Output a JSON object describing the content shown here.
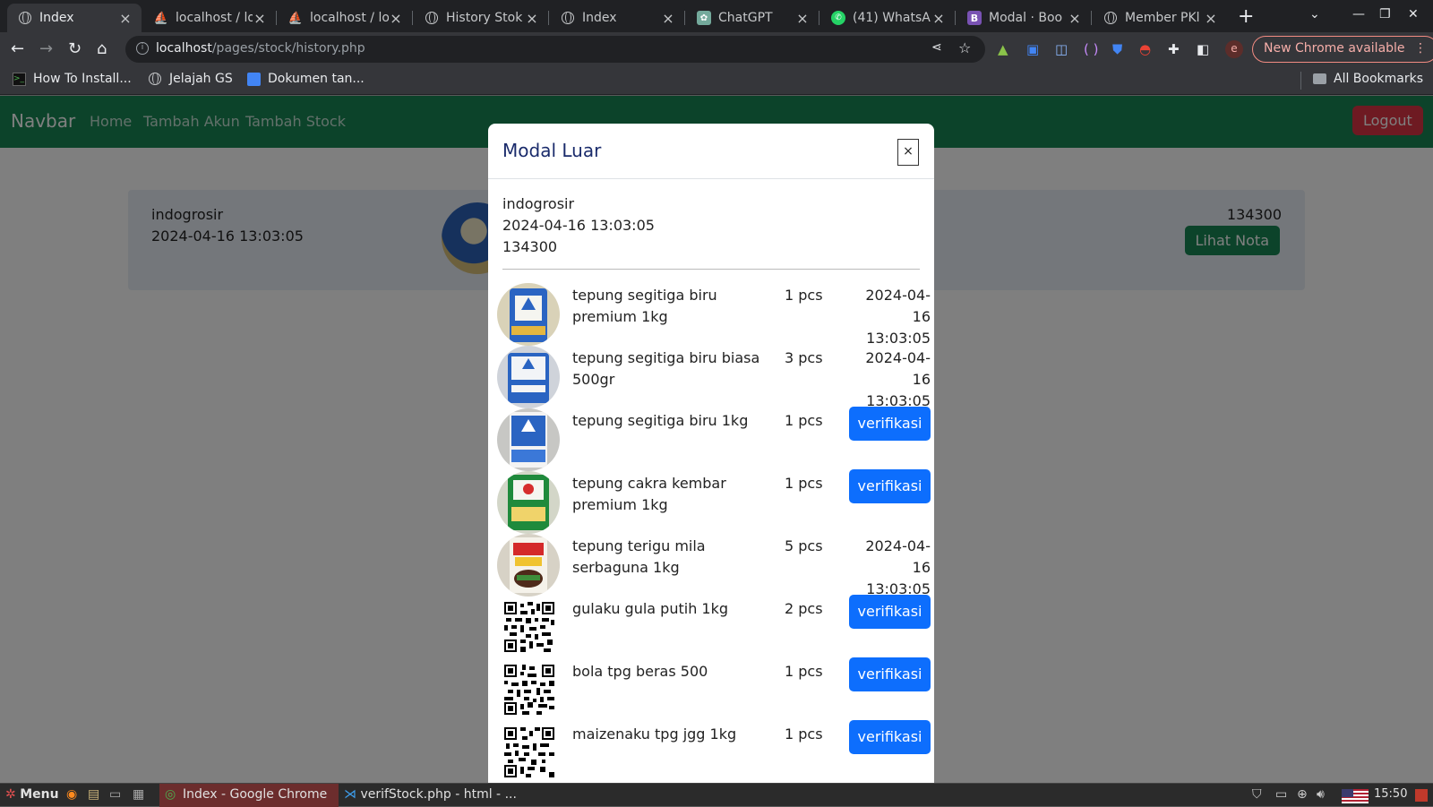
{
  "browser": {
    "tabs": [
      {
        "title": "Index",
        "icon": "globe-icon",
        "active": true
      },
      {
        "title": "localhost / lo",
        "icon": "phpmyadmin-icon"
      },
      {
        "title": "localhost / lo",
        "icon": "phpmyadmin-icon"
      },
      {
        "title": "History Stok",
        "icon": "globe-icon"
      },
      {
        "title": "Index",
        "icon": "globe-icon"
      },
      {
        "title": "ChatGPT",
        "icon": "chatgpt-icon"
      },
      {
        "title": "(41) WhatsA",
        "icon": "whatsapp-icon"
      },
      {
        "title": "Modal · Boo",
        "icon": "bootstrap-icon"
      },
      {
        "title": "Member PKl",
        "icon": "globe-icon"
      }
    ],
    "url_host": "localhost",
    "url_path": "/pages/stock/history.php",
    "update_button": "New Chrome available",
    "profile_initial": "e",
    "bookmarks": [
      "How To Install...",
      "Jelajah GS",
      "Dokumen tan..."
    ],
    "all_bookmarks": "All Bookmarks"
  },
  "navbar": {
    "brand": "Navbar",
    "links": [
      "Home",
      "Tambah Akun",
      "Tambah Stock"
    ],
    "logout": "Logout"
  },
  "card": {
    "store": "indogrosir",
    "date": "2024-04-16 13:03:05",
    "total": "134300",
    "button": "Lihat Nota"
  },
  "modal": {
    "title": "Modal Luar",
    "close": "×",
    "store": "indogrosir",
    "date": "2024-04-16 13:03:05",
    "total": "134300",
    "items": [
      {
        "name": "tepung segitiga biru premium 1kg",
        "qty": "1 pcs",
        "status_date": "2024-04-16 13:03:05",
        "verified": true
      },
      {
        "name": "tepung segitiga biru biasa 500gr",
        "qty": "3 pcs",
        "status_date": "2024-04-16 13:03:05",
        "verified": true
      },
      {
        "name": "tepung segitiga biru 1kg",
        "qty": "1 pcs",
        "action": "verifikasi",
        "verified": false
      },
      {
        "name": "tepung cakra kembar premium 1kg",
        "qty": "1 pcs",
        "action": "verifikasi",
        "verified": false
      },
      {
        "name": "tepung terigu mila serbaguna 1kg",
        "qty": "5 pcs",
        "status_date": "2024-04-16 13:03:05",
        "verified": true
      },
      {
        "name": "gulaku gula putih 1kg",
        "qty": "2 pcs",
        "action": "verifikasi",
        "verified": false
      },
      {
        "name": "bola tpg beras 500",
        "qty": "1 pcs",
        "action": "verifikasi",
        "verified": false
      },
      {
        "name": "maizenaku tpg jgg 1kg",
        "qty": "1 pcs",
        "action": "verifikasi",
        "verified": false
      }
    ]
  },
  "taskbar": {
    "menu": "Menu",
    "apps": [
      "Index - Google Chrome",
      "verifStock.php - html - ..."
    ],
    "time": "15:50"
  },
  "colors": {
    "navbar": "#198754",
    "primary": "#0d6efd",
    "danger": "#dc3545"
  }
}
